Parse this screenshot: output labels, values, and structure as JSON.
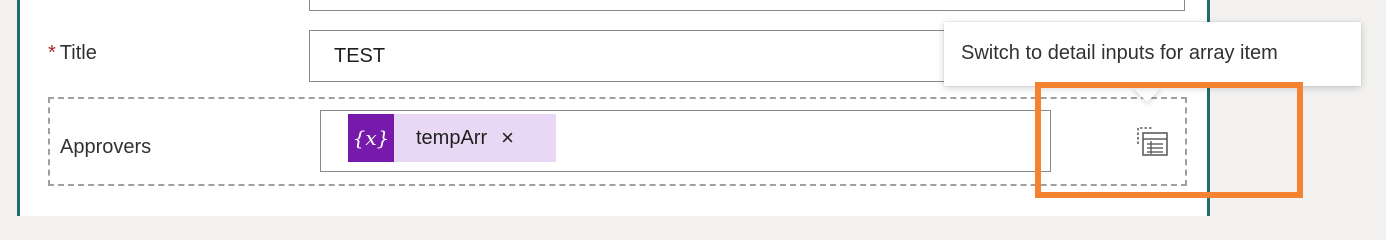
{
  "form": {
    "title_field": {
      "required_marker": "*",
      "label": "Title",
      "value": "TEST"
    },
    "approvers_field": {
      "label": "Approvers",
      "token": {
        "icon_text": "{x}",
        "label": "tempArr",
        "remove_glyph": "×"
      },
      "detail_button_icon": "detail-inputs-icon"
    }
  },
  "tooltip": {
    "text": "Switch to detail inputs for array item"
  },
  "colors": {
    "card_border": "#1e6f6b",
    "token_icon_bg": "#7719aa",
    "token_bg": "#e9d8f5",
    "highlight": "#f58231",
    "required": "#a4262c"
  }
}
